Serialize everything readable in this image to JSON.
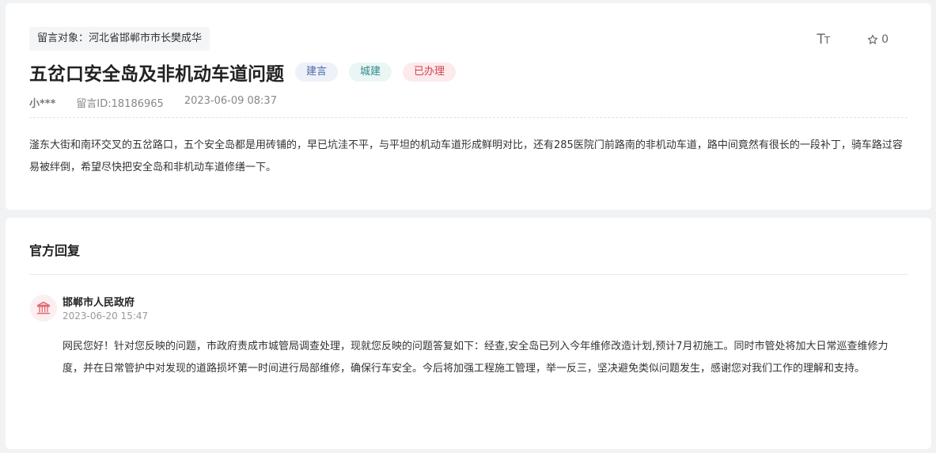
{
  "message": {
    "target": "留言对象：河北省邯郸市市长樊成华",
    "title": "五岔口安全岛及非机动车道问题",
    "tags": [
      {
        "label": "建言"
      },
      {
        "label": "城建"
      },
      {
        "label": "已办理"
      }
    ],
    "author": "小***",
    "message_id": "留言ID:18186965",
    "datetime": "2023-06-09 08:37",
    "content": "滏东大街和南环交叉的五岔路口，五个安全岛都是用砖铺的，早已坑洼不平，与平坦的机动车道形成鲜明对比，还有285医院门前路南的非机动车道，路中间竟然有很长的一段补丁，骑车路过容易被绊倒，希望尽快把安全岛和非机动车道修缮一下。",
    "star_count": "0",
    "font_icon": "font-size-icon",
    "star_icon": "star-outline-icon"
  },
  "reply": {
    "section_title": "官方回复",
    "org_name": "邯郸市人民政府",
    "datetime": "2023-06-20 15:47",
    "content": "网民您好！针对您反映的问题，市政府责成市城管局调查处理，现就您反映的问题答复如下：经查,安全岛已列入今年维修改造计划,预计7月初施工。同时市管处将加大日常巡查维修力度，并在日常管护中对发现的道路损坏第一时间进行局部维修，确保行车安全。今后将加强工程施工管理，举一反三，坚决避免类似问题发生，感谢您对我们工作的理解和支持。",
    "avatar_icon": "government-building-icon"
  },
  "colors": {
    "accent_red": "#d0434d",
    "tag_blue": "#4a6aa8",
    "tag_teal": "#2f8a8a"
  }
}
